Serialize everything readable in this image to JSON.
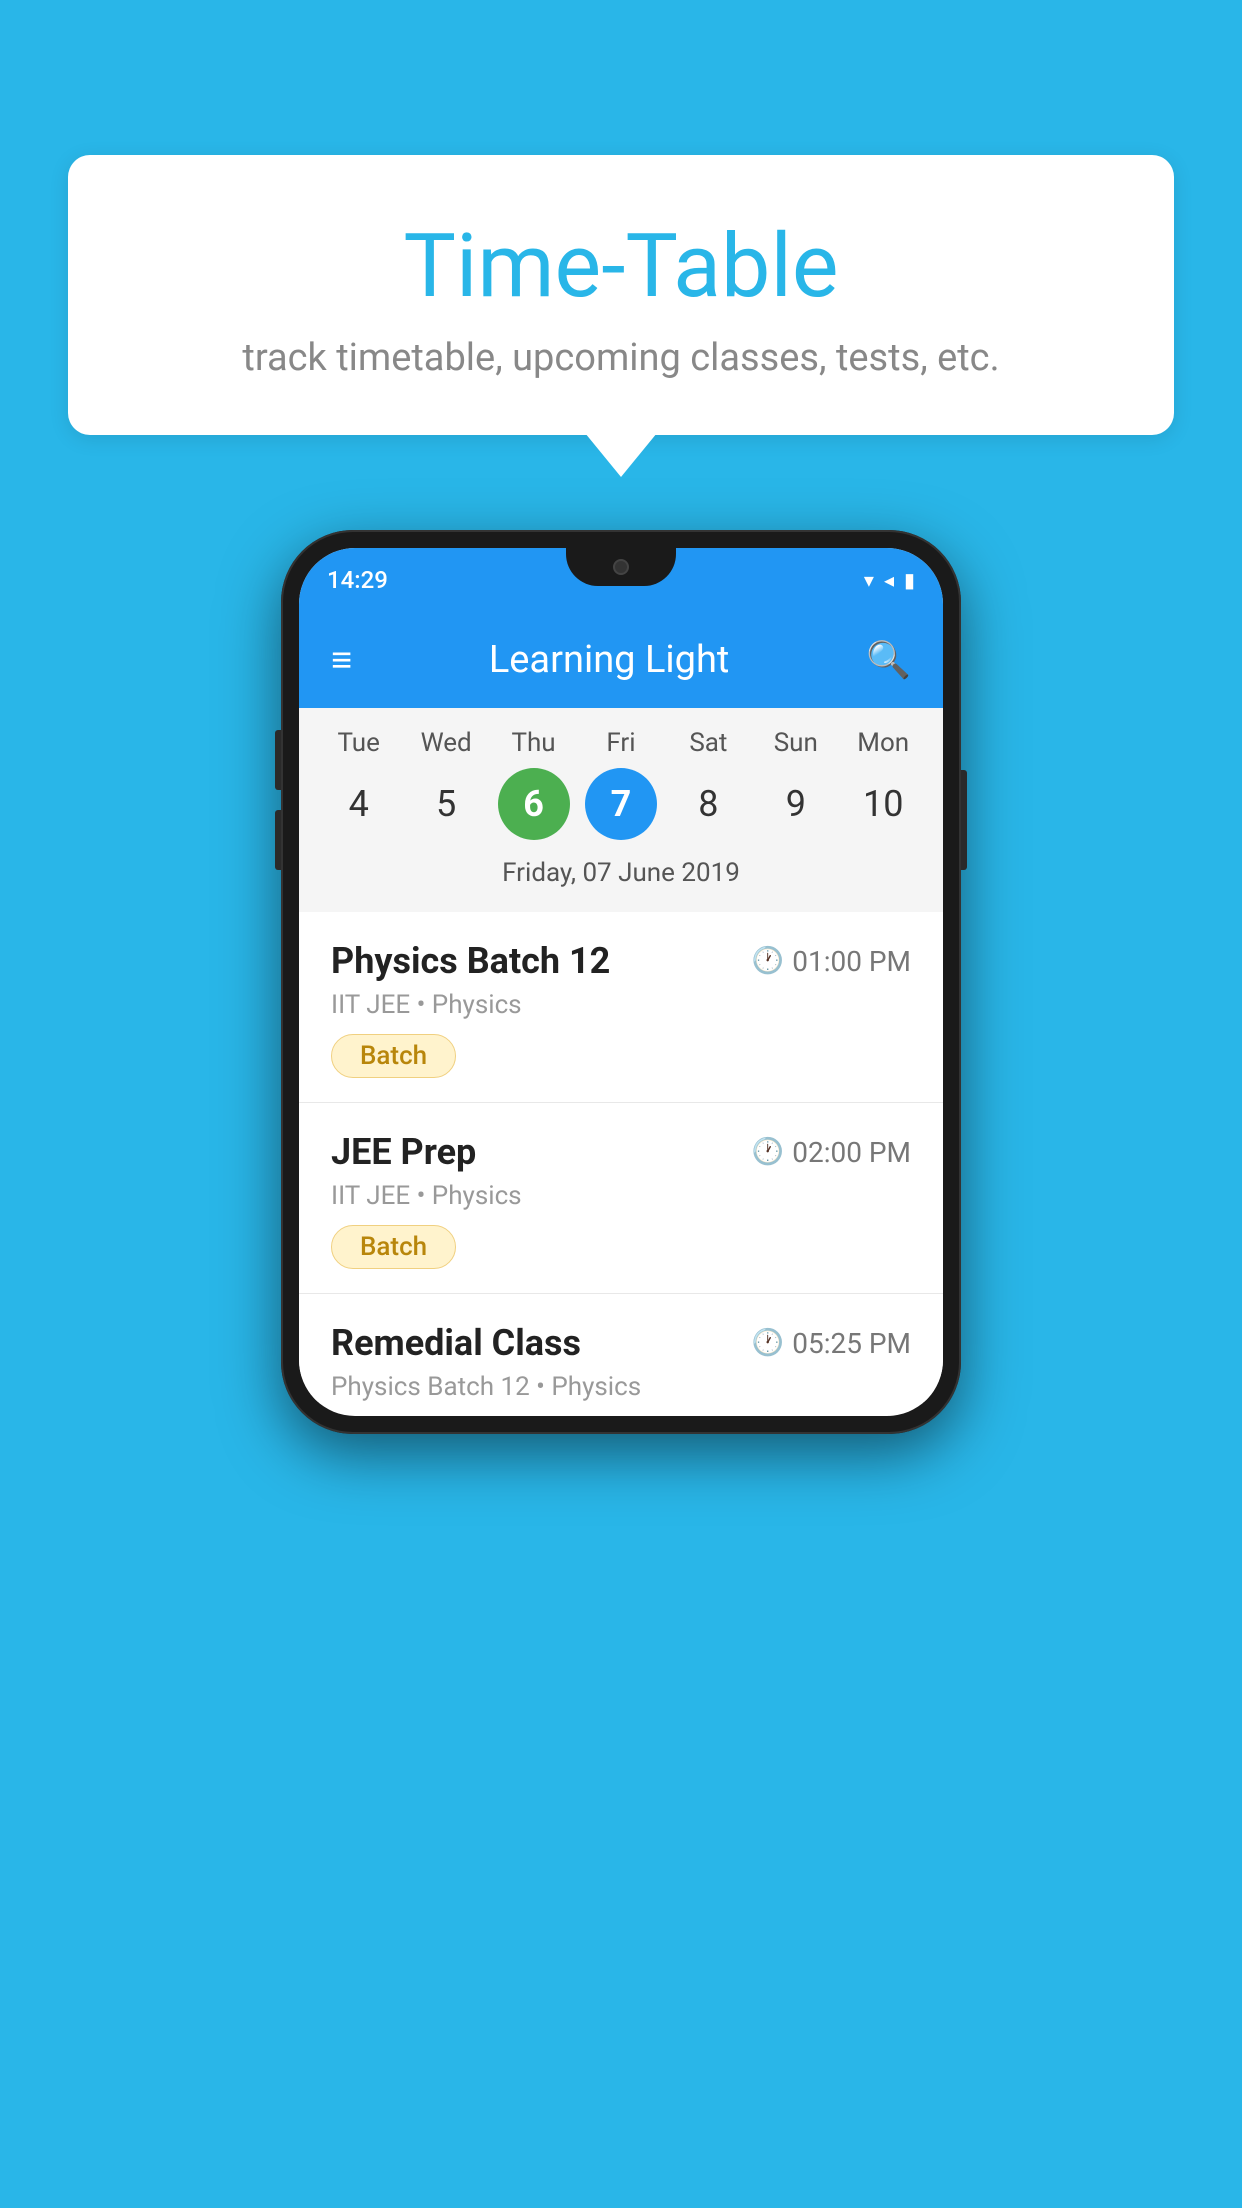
{
  "background_color": "#29b6e8",
  "speech_bubble": {
    "title": "Time-Table",
    "subtitle": "track timetable, upcoming classes, tests, etc."
  },
  "phone": {
    "status_bar": {
      "time": "14:29"
    },
    "app_bar": {
      "title": "Learning Light"
    },
    "calendar": {
      "days": [
        {
          "abbr": "Tue",
          "num": "4"
        },
        {
          "abbr": "Wed",
          "num": "5"
        },
        {
          "abbr": "Thu",
          "num": "6",
          "state": "today"
        },
        {
          "abbr": "Fri",
          "num": "7",
          "state": "selected"
        },
        {
          "abbr": "Sat",
          "num": "8"
        },
        {
          "abbr": "Sun",
          "num": "9"
        },
        {
          "abbr": "Mon",
          "num": "10"
        }
      ],
      "selected_date_label": "Friday, 07 June 2019"
    },
    "schedule": [
      {
        "title": "Physics Batch 12",
        "time": "01:00 PM",
        "subtitle": "IIT JEE • Physics",
        "tag": "Batch"
      },
      {
        "title": "JEE Prep",
        "time": "02:00 PM",
        "subtitle": "IIT JEE • Physics",
        "tag": "Batch"
      },
      {
        "title": "Remedial Class",
        "time": "05:25 PM",
        "subtitle": "Physics Batch 12 • Physics",
        "tag": null
      }
    ]
  }
}
